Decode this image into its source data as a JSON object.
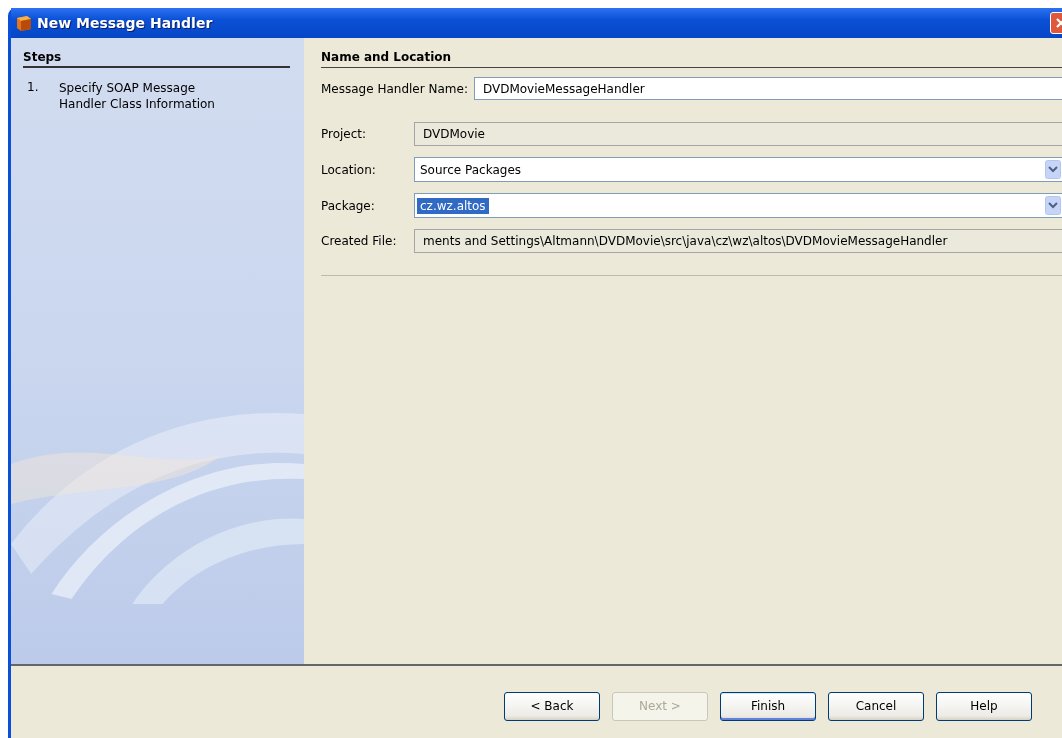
{
  "window": {
    "title": "New Message Handler"
  },
  "steps": {
    "heading": "Steps",
    "items": [
      {
        "number": "1.",
        "label": "Specify SOAP Message Handler Class Information",
        "selected": false
      }
    ]
  },
  "panel": {
    "heading": "Name and Location"
  },
  "name_field": {
    "label": "Message Handler Name:",
    "value": "DVDMovieMessageHandler"
  },
  "fields": [
    {
      "kind": "readonly",
      "label": "Project:",
      "value": "DVDMovie"
    },
    {
      "kind": "combo",
      "label": "Location:",
      "value": "Source Packages",
      "text_selected": false
    },
    {
      "kind": "combo",
      "label": "Package:",
      "value": "cz.wz.altos",
      "text_selected": true
    },
    {
      "kind": "readonly",
      "label": "Created File:",
      "value": "ments and Settings\\Altmann\\DVDMovie\\src\\java\\cz\\wz\\altos\\DVDMovieMessageHandler"
    }
  ],
  "buttons": [
    {
      "label": "< Back",
      "disabled": false,
      "default": false
    },
    {
      "label": "Next >",
      "disabled": true,
      "default": false
    },
    {
      "label": "Finish",
      "disabled": false,
      "default": true
    },
    {
      "label": "Cancel",
      "disabled": false,
      "default": false
    },
    {
      "label": "Help",
      "disabled": false,
      "default": false
    }
  ]
}
